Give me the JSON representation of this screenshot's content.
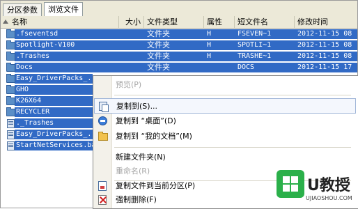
{
  "tabs": [
    {
      "label": "分区参数",
      "active": false
    },
    {
      "label": "浏览文件",
      "active": true
    }
  ],
  "columns": {
    "name": "名称",
    "size": "大小",
    "type": "文件类型",
    "attr": "属性",
    "short": "短文件名",
    "modified": "修改时间"
  },
  "files": [
    {
      "name": ".fseventsd",
      "icon": "folder-icon",
      "type": "文件夹",
      "attr": "H",
      "short": "FSEVEN~1",
      "modified": "2012-11-15 08"
    },
    {
      "name": "Spotlight-V100",
      "icon": "folder-icon",
      "type": "文件夹",
      "attr": "H",
      "short": "SPOTLI~1",
      "modified": "2012-11-15 08"
    },
    {
      "name": ".Trashes",
      "icon": "folder-icon",
      "type": "文件夹",
      "attr": "H",
      "short": "TRASHE~1",
      "modified": "2012-11-15 08"
    },
    {
      "name": "Docs",
      "icon": "folder-icon",
      "type": "文件夹",
      "attr": "",
      "short": "DOCS",
      "modified": "2012-11-15 17"
    },
    {
      "name": "Easy_DriverPacks_...",
      "icon": "folder-icon",
      "type": "",
      "attr": "",
      "short": "",
      "modified": ""
    },
    {
      "name": "GHO",
      "icon": "folder-icon",
      "type": "",
      "attr": "",
      "short": "",
      "modified": ""
    },
    {
      "name": "K26X64",
      "icon": "folder-icon",
      "type": "",
      "attr": "",
      "short": "",
      "modified": ""
    },
    {
      "name": "RECYCLER",
      "icon": "folder-icon",
      "type": "",
      "attr": "",
      "short": "",
      "modified": ""
    },
    {
      "name": "._Trashes",
      "icon": "file-icon",
      "type": "",
      "attr": "",
      "short": "",
      "modified": ""
    },
    {
      "name": "Easy_DriverPacks_...",
      "icon": "file-icon",
      "type": "",
      "attr": "",
      "short": "",
      "modified": ""
    },
    {
      "name": "StartNetServices.ba",
      "icon": "file-icon",
      "type": "",
      "attr": "",
      "short": "",
      "modified": ""
    }
  ],
  "context_menu": [
    {
      "label": "预览(P)",
      "enabled": false,
      "icon": ""
    },
    {
      "label": "复制到(S)...",
      "enabled": true,
      "icon": "copy-icon",
      "hover": true
    },
    {
      "label": "复制到 “桌面”(D)",
      "enabled": true,
      "icon": "desktop-icon"
    },
    {
      "label": "复制到 “我的文档”(M)",
      "enabled": true,
      "icon": "documents-folder-icon"
    },
    {
      "label": "新建文件夹(N)",
      "enabled": true,
      "icon": ""
    },
    {
      "label": "重命名(R)",
      "enabled": false,
      "icon": ""
    },
    {
      "label": "复制文件到当前分区(P)",
      "enabled": true,
      "icon": "copy-here-icon"
    },
    {
      "label": "强制删除(F)",
      "enabled": true,
      "icon": "force-delete-icon"
    }
  ],
  "watermark": {
    "brand": "U教授",
    "url": "UJIAOSHOU.COM"
  },
  "colors": {
    "selection": "#316ac5",
    "header": "#ece9d8",
    "watermark_green": "#2bb04a"
  }
}
